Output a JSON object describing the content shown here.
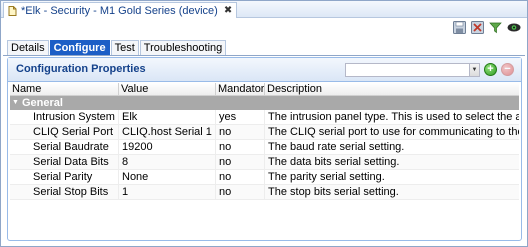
{
  "window": {
    "title": "*Elk - Security - M1 Gold Series (device)",
    "close_glyph": "✖"
  },
  "toolbar": {
    "icons": [
      "save-icon",
      "save-close-icon",
      "filter-icon",
      "visibility-icon"
    ]
  },
  "tabs": [
    {
      "label": "Details",
      "active": false
    },
    {
      "label": "Configure",
      "active": true
    },
    {
      "label": "Test",
      "active": false
    },
    {
      "label": "Troubleshooting",
      "active": false
    }
  ],
  "panel": {
    "title": "Configuration Properties",
    "combo_value": "",
    "add_glyph": "+",
    "remove_glyph": "−"
  },
  "grid": {
    "columns": [
      "Name",
      "Value",
      "Mandatory",
      "Description"
    ],
    "group": {
      "label": "General",
      "caret": "▼"
    },
    "rows": [
      {
        "name": "Intrusion System",
        "value": "Elk",
        "mandatory": "yes",
        "description": "The intrusion panel type. This is used to select the appropr"
      },
      {
        "name": "CLIQ Serial Port",
        "value": "CLIQ.host Serial 1",
        "mandatory": "no",
        "description": "The CLIQ serial port to use for communicating to the devic"
      },
      {
        "name": "Serial Baudrate",
        "value": "19200",
        "mandatory": "no",
        "description": "The baud rate serial setting."
      },
      {
        "name": "Serial Data Bits",
        "value": "8",
        "mandatory": "no",
        "description": "The data bits serial setting."
      },
      {
        "name": "Serial Parity",
        "value": "None",
        "mandatory": "no",
        "description": "The parity serial setting."
      },
      {
        "name": "Serial Stop Bits",
        "value": "1",
        "mandatory": "no",
        "description": "The stop bits serial setting."
      }
    ]
  },
  "colors": {
    "accent": "#1c5ec6",
    "group_bg": "#a9a9a9",
    "title_text": "#15428b"
  }
}
